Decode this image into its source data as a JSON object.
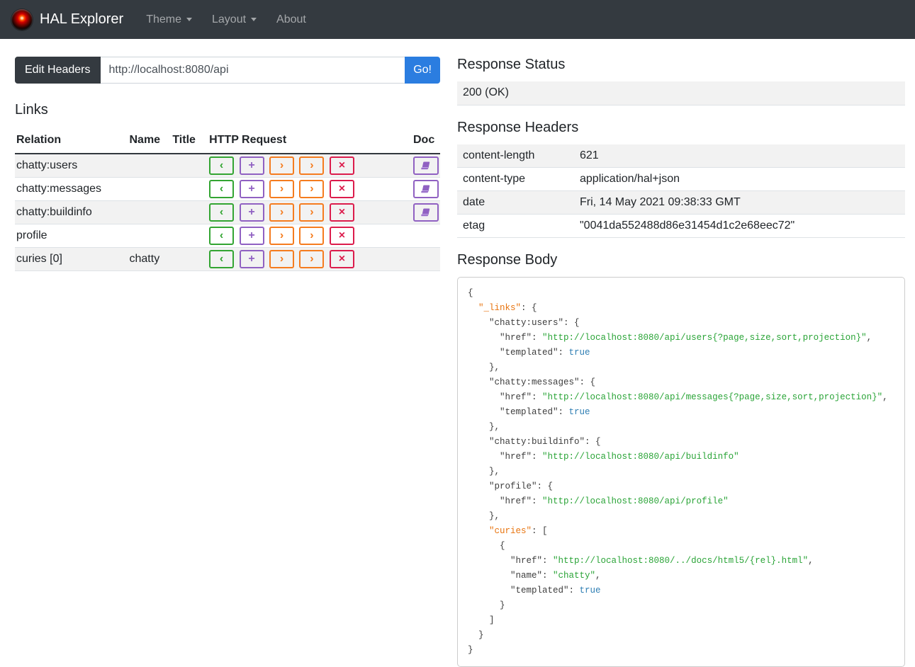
{
  "navbar": {
    "brand": "HAL Explorer",
    "theme_label": "Theme",
    "layout_label": "Layout",
    "about_label": "About"
  },
  "request_bar": {
    "edit_headers_label": "Edit Headers",
    "url_value": "http://localhost:8080/api",
    "go_label": "Go!"
  },
  "accents": {
    "navbar_bg": "#343a40",
    "go_button_blue": "#2b7de0",
    "get_green": "#33a532",
    "post_purple": "#9061c2",
    "put_patch_orange": "#f57c1f",
    "delete_red": "#dc1c4c",
    "doc_purple": "#9061c2",
    "json_key_orange": "#e8740f",
    "json_string_green": "#2aa437",
    "json_bool_blue": "#2e7eb3"
  },
  "links_section": {
    "title": "Links",
    "columns": [
      "Relation",
      "Name",
      "Title",
      "HTTP Request",
      "Doc"
    ],
    "http_buttons": {
      "get": "‹",
      "post": "+",
      "put": "›",
      "patch": "›",
      "delete": "×"
    },
    "rows": [
      {
        "relation": "chatty:users",
        "name": "",
        "title": "",
        "doc": true
      },
      {
        "relation": "chatty:messages",
        "name": "",
        "title": "",
        "doc": true
      },
      {
        "relation": "chatty:buildinfo",
        "name": "",
        "title": "",
        "doc": true
      },
      {
        "relation": "profile",
        "name": "",
        "title": "",
        "doc": false
      },
      {
        "relation": "curies [0]",
        "name": "chatty",
        "title": "",
        "doc": false
      }
    ]
  },
  "response": {
    "status_title": "Response Status",
    "status_value": "200 (OK)",
    "headers_title": "Response Headers",
    "headers": [
      {
        "key": "content-length",
        "value": "621"
      },
      {
        "key": "content-type",
        "value": "application/hal+json"
      },
      {
        "key": "date",
        "value": "Fri, 14 May 2021 09:38:33 GMT"
      },
      {
        "key": "etag",
        "value": "\"0041da552488d86e31454d1c2e68eec72\""
      }
    ],
    "body_title": "Response Body",
    "body_lines": [
      [
        {
          "t": "{",
          "c": "p"
        }
      ],
      [
        {
          "t": "  ",
          "c": "p"
        },
        {
          "t": "\"_links\"",
          "c": "o"
        },
        {
          "t": ": {",
          "c": "p"
        }
      ],
      [
        {
          "t": "    \"chatty:users\": {",
          "c": "p"
        }
      ],
      [
        {
          "t": "      \"href\": ",
          "c": "p"
        },
        {
          "t": "\"http://localhost:8080/api/users{?page,size,sort,projection}\"",
          "c": "s"
        },
        {
          "t": ",",
          "c": "p"
        }
      ],
      [
        {
          "t": "      \"templated\": ",
          "c": "p"
        },
        {
          "t": "true",
          "c": "b"
        }
      ],
      [
        {
          "t": "    },",
          "c": "p"
        }
      ],
      [
        {
          "t": "    \"chatty:messages\": {",
          "c": "p"
        }
      ],
      [
        {
          "t": "      \"href\": ",
          "c": "p"
        },
        {
          "t": "\"http://localhost:8080/api/messages{?page,size,sort,projection}\"",
          "c": "s"
        },
        {
          "t": ",",
          "c": "p"
        }
      ],
      [
        {
          "t": "      \"templated\": ",
          "c": "p"
        },
        {
          "t": "true",
          "c": "b"
        }
      ],
      [
        {
          "t": "    },",
          "c": "p"
        }
      ],
      [
        {
          "t": "    \"chatty:buildinfo\": {",
          "c": "p"
        }
      ],
      [
        {
          "t": "      \"href\": ",
          "c": "p"
        },
        {
          "t": "\"http://localhost:8080/api/buildinfo\"",
          "c": "s"
        }
      ],
      [
        {
          "t": "    },",
          "c": "p"
        }
      ],
      [
        {
          "t": "    \"profile\": {",
          "c": "p"
        }
      ],
      [
        {
          "t": "      \"href\": ",
          "c": "p"
        },
        {
          "t": "\"http://localhost:8080/api/profile\"",
          "c": "s"
        }
      ],
      [
        {
          "t": "    },",
          "c": "p"
        }
      ],
      [
        {
          "t": "    ",
          "c": "p"
        },
        {
          "t": "\"curies\"",
          "c": "o"
        },
        {
          "t": ": [",
          "c": "p"
        }
      ],
      [
        {
          "t": "      {",
          "c": "p"
        }
      ],
      [
        {
          "t": "        \"href\": ",
          "c": "p"
        },
        {
          "t": "\"http://localhost:8080/../docs/html5/{rel}.html\"",
          "c": "s"
        },
        {
          "t": ",",
          "c": "p"
        }
      ],
      [
        {
          "t": "        \"name\": ",
          "c": "p"
        },
        {
          "t": "\"chatty\"",
          "c": "s"
        },
        {
          "t": ",",
          "c": "p"
        }
      ],
      [
        {
          "t": "        \"templated\": ",
          "c": "p"
        },
        {
          "t": "true",
          "c": "b"
        }
      ],
      [
        {
          "t": "      }",
          "c": "p"
        }
      ],
      [
        {
          "t": "    ]",
          "c": "p"
        }
      ],
      [
        {
          "t": "  }",
          "c": "p"
        }
      ],
      [
        {
          "t": "}",
          "c": "p"
        }
      ]
    ]
  }
}
